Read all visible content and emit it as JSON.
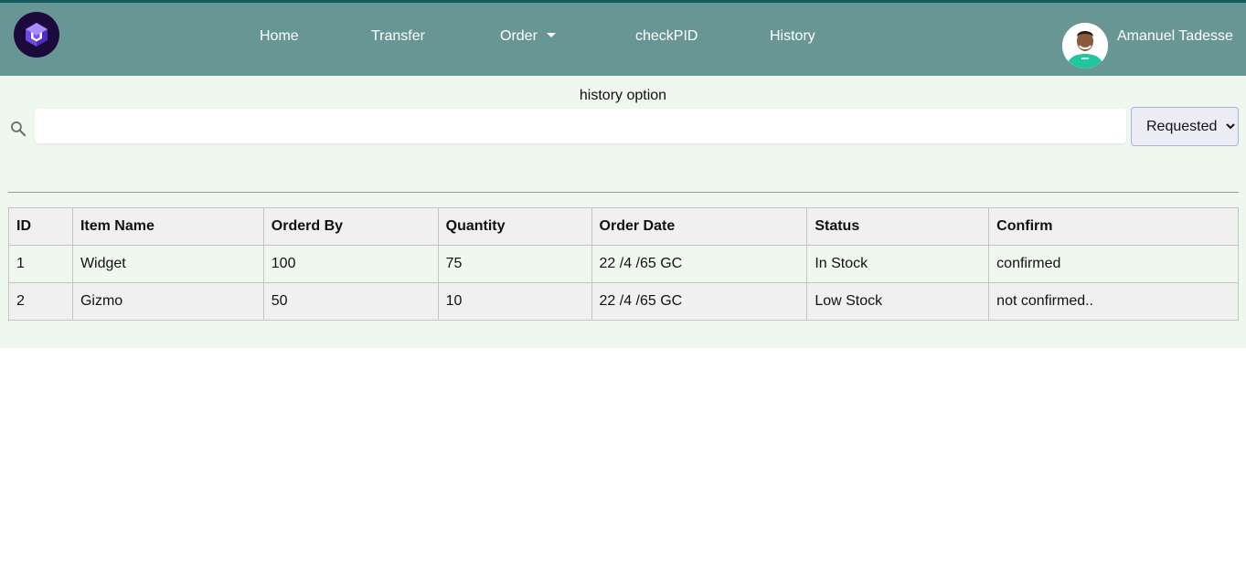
{
  "nav": {
    "items": [
      {
        "label": "Home"
      },
      {
        "label": "Transfer"
      },
      {
        "label": "Order"
      },
      {
        "label": "checkPID"
      },
      {
        "label": "History"
      }
    ],
    "user_name": "Amanuel Tadesse",
    "logo_icon": "hexagon-cube-logo",
    "dropdown_icon": "caret-down-icon"
  },
  "page": {
    "title": "history option"
  },
  "search": {
    "icon": "search-icon",
    "value": "",
    "placeholder": ""
  },
  "filter": {
    "selected": "Requested"
  },
  "table": {
    "headers": [
      "ID",
      "Item Name",
      "Orderd By",
      "Quantity",
      "Order Date",
      "Status",
      "Confirm"
    ],
    "rows": [
      [
        "1",
        "Widget",
        "100",
        "75",
        "22 /4 /65 GC",
        "In Stock",
        "confirmed"
      ],
      [
        "2",
        "Gizmo",
        "50",
        "10",
        "22 /4 /65 GC",
        "Low Stock",
        "not confirmed.."
      ]
    ]
  },
  "colors": {
    "navbar": "#679694",
    "navbar_border": "#0f5c5a",
    "content_bg": "#eff8ef",
    "logo_bg": "#1d0a3d"
  }
}
